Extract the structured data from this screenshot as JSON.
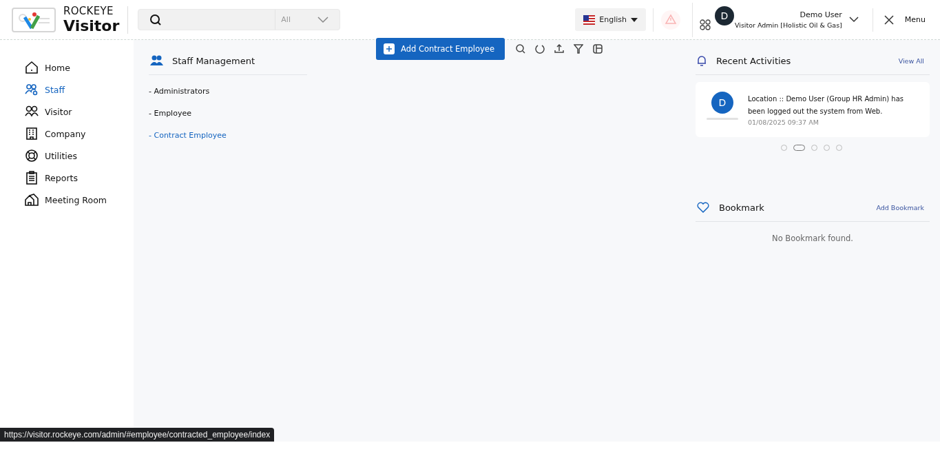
{
  "logo": {
    "line1": "ROCKEYE",
    "line2": "Visitor"
  },
  "search": {
    "scope": "All"
  },
  "language": {
    "label": "English"
  },
  "user": {
    "initial": "D",
    "name": "Demo User",
    "role": "Visitor Admin [Holistic Oil & Gas]"
  },
  "menu_button": {
    "label": "Menu"
  },
  "sidebar": {
    "items": [
      {
        "label": "Home",
        "selected": false
      },
      {
        "label": "Staff",
        "selected": true
      },
      {
        "label": "Visitor",
        "selected": false
      },
      {
        "label": "Company",
        "selected": false
      },
      {
        "label": "Utilities",
        "selected": false
      },
      {
        "label": "Reports",
        "selected": false
      },
      {
        "label": "Meeting Room",
        "selected": false
      }
    ]
  },
  "staff_panel": {
    "title": "Staff Management",
    "items": [
      {
        "label": "- Administrators",
        "selected": false
      },
      {
        "label": "- Employee",
        "selected": false
      },
      {
        "label": "- Contract Employee",
        "selected": true
      }
    ]
  },
  "toolbar": {
    "add_button": "Add Contract Employee"
  },
  "recent_activities": {
    "title": "Recent Activities",
    "link": "View All",
    "activity": {
      "initial": "D",
      "text": "Location :: Demo User (Group HR Admin) has been logged out the system from Web.",
      "time": "01/08/2025 09:37 AM"
    },
    "dots": [
      {
        "selected": false
      },
      {
        "selected": true
      },
      {
        "selected": false
      },
      {
        "selected": false
      },
      {
        "selected": false
      }
    ]
  },
  "bookmark": {
    "title": "Bookmark",
    "link": "Add Bookmark",
    "empty": "No Bookmark found."
  },
  "status_bar": {
    "url": "https://visitor.rockeye.com/admin/#employee/contracted_employee/index"
  }
}
